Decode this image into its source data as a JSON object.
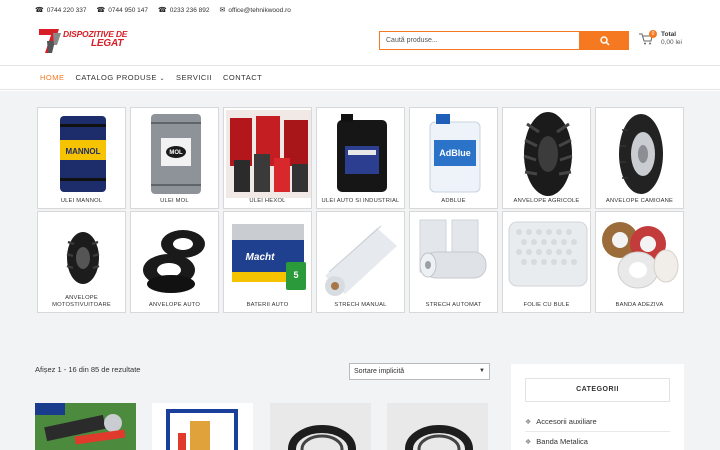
{
  "topbar": {
    "phone1": "0744 220 337",
    "phone2": "0744 950 147",
    "phone3": "0233 236 892",
    "email": "office@tehnikwood.ro"
  },
  "logo": {
    "line1": "DISPOZITIVE DE",
    "line2": "LEGAT"
  },
  "search": {
    "placeholder": "Caută produse..."
  },
  "cart": {
    "count": "0",
    "total_label": "Total",
    "amount": "0,00 lei"
  },
  "nav": {
    "items": [
      "HOME",
      "CATALOG PRODUSE",
      "SERVICII",
      "CONTACT"
    ],
    "active": "HOME"
  },
  "categories_grid": [
    {
      "label": "ULEI MANNOL",
      "icon": "mannol-barrel"
    },
    {
      "label": "ULEI MOL",
      "icon": "mol-barrel"
    },
    {
      "label": "ULEI HEXOL",
      "icon": "hexol-cans"
    },
    {
      "label": "ULEI AUTO SI INDUSTRIAL",
      "icon": "black-canister"
    },
    {
      "label": "ADBLUE",
      "icon": "adblue-canister"
    },
    {
      "label": "ANVELOPE AGRICOLE",
      "icon": "agricultural-tire"
    },
    {
      "label": "ANVELOPE CAMIOANE",
      "icon": "truck-tire"
    },
    {
      "label": "ANVELOPE MOTOSTIVUITOARE",
      "icon": "forklift-tire"
    },
    {
      "label": "ANVELOPE AUTO",
      "icon": "car-tires"
    },
    {
      "label": "BATERII AUTO",
      "icon": "car-battery"
    },
    {
      "label": "STRECH MANUAL",
      "icon": "stretch-roll"
    },
    {
      "label": "STRECH AUTOMAT",
      "icon": "stretch-rolls"
    },
    {
      "label": "FOLIE CU BULE",
      "icon": "bubble-wrap"
    },
    {
      "label": "BANDA ADEZIVA",
      "icon": "tape-rolls"
    }
  ],
  "shop": {
    "results_text": "Afișez 1 - 16 din 85 de rezultate",
    "sort_selected": "Sortare implicită"
  },
  "sidebar": {
    "title": "CATEGORII",
    "items": [
      "Accesorii auxiliare",
      "Banda Metalica"
    ]
  },
  "colors": {
    "accent": "#f47920",
    "brand_red": "#d71f27",
    "bg_gray": "#f2f3f5"
  }
}
